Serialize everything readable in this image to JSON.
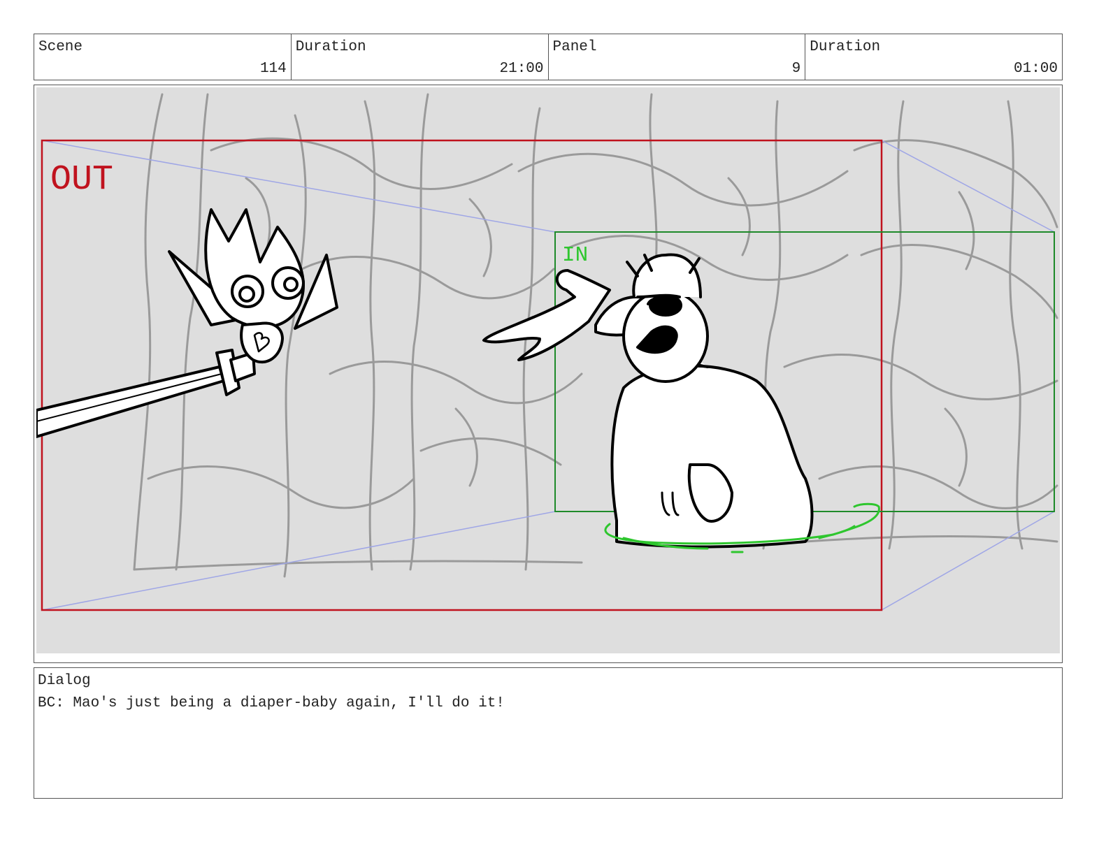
{
  "header": {
    "scene_label": "Scene",
    "scene_value": "114",
    "scene_duration_label": "Duration",
    "scene_duration_value": "21:00",
    "panel_label": "Panel",
    "panel_value": "9",
    "panel_duration_label": "Duration",
    "panel_duration_value": "01:00"
  },
  "panel": {
    "out_label": "OUT",
    "in_label": "IN",
    "colors": {
      "background": "#dedede",
      "out_frame": "#c0121e",
      "in_frame": "#1e8a2a",
      "camera_lines": "#9fa6e6",
      "puddle": "#2ec62e"
    }
  },
  "dialog": {
    "label": "Dialog",
    "text": "BC: Mao's just being a diaper-baby again, I'll do it!"
  }
}
